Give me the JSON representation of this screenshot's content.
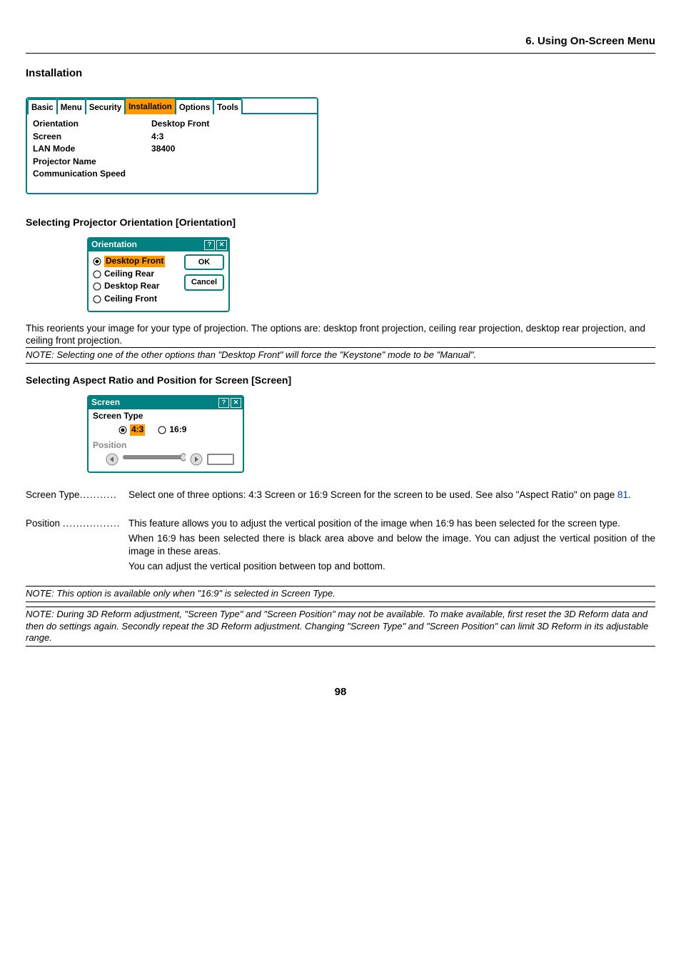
{
  "chapter": "6. Using On-Screen Menu",
  "h_installation": "Installation",
  "tabs": {
    "basic": "Basic",
    "menu": "Menu",
    "security": "Security",
    "installation": "Installation",
    "options": "Options",
    "tools": "Tools"
  },
  "installation_panel": {
    "labels": {
      "orientation": "Orientation",
      "screen": "Screen",
      "lan_mode": "LAN Mode",
      "projector_name": "Projector Name",
      "comm_speed": "Communication Speed"
    },
    "values": {
      "orientation": "Desktop Front",
      "screen": "4:3",
      "lan_mode": "",
      "projector_name": "",
      "comm_speed": "38400"
    }
  },
  "h_orientation": "Selecting Projector Orientation [Orientation]",
  "orientation_dlg": {
    "title": "Orientation",
    "options": {
      "desktop_front": "Desktop Front",
      "ceiling_rear": "Ceiling Rear",
      "desktop_rear": "Desktop Rear",
      "ceiling_front": "Ceiling Front"
    },
    "ok": "OK",
    "cancel": "Cancel"
  },
  "orientation_text": "This reorients your image for your type of projection. The options are: desktop front projection, ceiling rear projection, desktop rear projection, and ceiling front projection.",
  "note1": "NOTE: Selecting one of the other options than \"Desktop Front\" will force the \"Keystone\" mode to be \"Manual\".",
  "h_screen": "Selecting Aspect Ratio and Position for Screen [Screen]",
  "screen_dlg": {
    "title": "Screen",
    "screen_type": "Screen Type",
    "r43": "4:3",
    "r169": "16:9",
    "position": "Position"
  },
  "def_screen_type": {
    "term": "Screen Type",
    "dots": "...........",
    "body_pre": "Select one of three options: 4:3 Screen or 16:9 Screen for the screen to be used. See also \"Aspect Ratio\" on page ",
    "page_link": "81",
    "body_post": "."
  },
  "def_position": {
    "term": "Position",
    "dots": ".................",
    "p1": "This feature allows you to adjust the vertical position of the image when 16:9 has been selected for the screen type.",
    "p2": "When 16:9 has been selected there is black area above and below the image. You can adjust the vertical position of the image in these areas.",
    "p3": "You can adjust the vertical position between top and bottom."
  },
  "note2": "NOTE: This option is available only when \"16:9\" is selected in Screen Type.",
  "note3": "NOTE: During 3D Reform adjustment, \"Screen Type\" and \"Screen Position\" may not be available. To make available, first reset the 3D Reform data and then do settings again. Secondly repeat the 3D Reform adjustment. Changing \"Screen Type\" and \"Screen Position\" can limit 3D Reform in its adjustable range.",
  "page_number": "98"
}
